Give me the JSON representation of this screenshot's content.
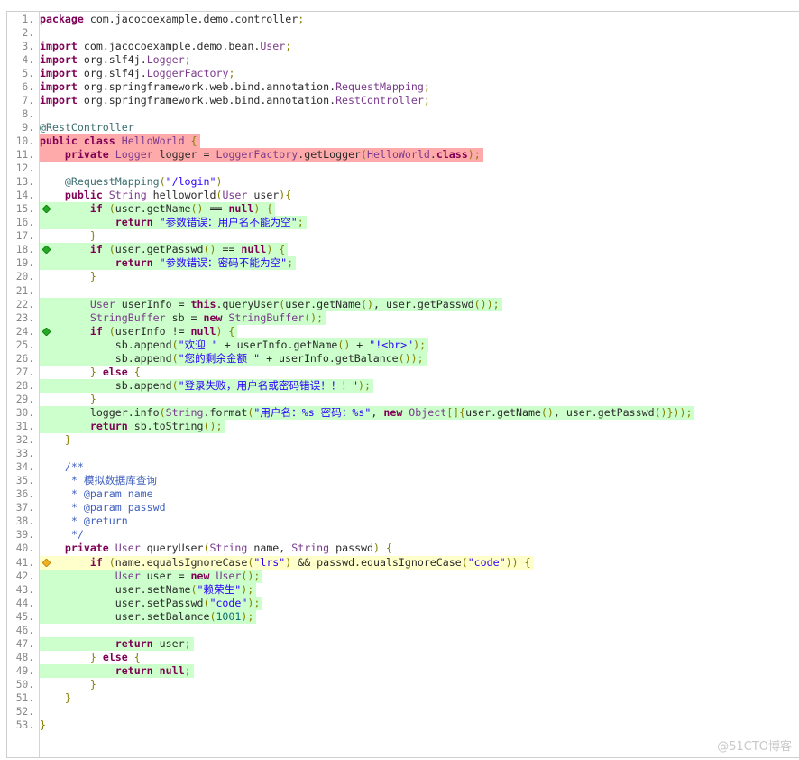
{
  "editor": {
    "language": "java",
    "coverage_colors": {
      "fully_covered": "#ccffcc",
      "not_covered": "#ffaaaa",
      "partially_covered": "#ffffcc",
      "branch_full_marker": "#22aa22",
      "branch_partial_marker": "#f0b020"
    },
    "lines": [
      {
        "n": "1.",
        "coverage": "none",
        "marker": "",
        "tokens": [
          [
            "kw",
            "package"
          ],
          [
            "",
            "com.jacocoexample.demo.controller"
          ],
          [
            "punc",
            ";"
          ]
        ]
      },
      {
        "n": "2.",
        "coverage": "none",
        "marker": "",
        "tokens": []
      },
      {
        "n": "3.",
        "coverage": "none",
        "marker": "",
        "tokens": [
          [
            "kw",
            "import"
          ],
          [
            "",
            "com.jacocoexample.demo.bean."
          ],
          [
            "ty",
            "User"
          ],
          [
            "punc",
            ";"
          ]
        ]
      },
      {
        "n": "4.",
        "coverage": "none",
        "marker": "",
        "tokens": [
          [
            "kw",
            "import"
          ],
          [
            "",
            "org.slf4j."
          ],
          [
            "ty",
            "Logger"
          ],
          [
            "punc",
            ";"
          ]
        ]
      },
      {
        "n": "5.",
        "coverage": "none",
        "marker": "",
        "tokens": [
          [
            "kw",
            "import"
          ],
          [
            "",
            "org.slf4j."
          ],
          [
            "ty",
            "LoggerFactory"
          ],
          [
            "punc",
            ";"
          ]
        ]
      },
      {
        "n": "6.",
        "coverage": "none",
        "marker": "",
        "tokens": [
          [
            "kw",
            "import"
          ],
          [
            "",
            "org.springframework.web.bind.annotation."
          ],
          [
            "ty",
            "RequestMapping"
          ],
          [
            "punc",
            ";"
          ]
        ]
      },
      {
        "n": "7.",
        "coverage": "none",
        "marker": "",
        "tokens": [
          [
            "kw",
            "import"
          ],
          [
            "",
            "org.springframework.web.bind.annotation."
          ],
          [
            "ty",
            "RestController"
          ],
          [
            "punc",
            ";"
          ]
        ]
      },
      {
        "n": "8.",
        "coverage": "none",
        "marker": "",
        "tokens": []
      },
      {
        "n": "9.",
        "coverage": "none",
        "marker": "",
        "tokens": [
          [
            "ann",
            "@RestController"
          ]
        ]
      },
      {
        "n": "10.",
        "coverage": "nc",
        "marker": "",
        "tokens": [
          [
            "kw",
            "public class"
          ],
          [
            "ty",
            " HelloWorld"
          ],
          [
            "punc",
            " {"
          ]
        ]
      },
      {
        "n": "11.",
        "coverage": "nc",
        "marker": "",
        "tokens": [
          [
            "",
            "    "
          ],
          [
            "kw",
            "private"
          ],
          [
            "ty",
            " Logger"
          ],
          [
            "",
            " logger = "
          ],
          [
            "ty",
            "LoggerFactory"
          ],
          [
            "",
            ".getLogger"
          ],
          [
            "punc",
            "("
          ],
          [
            "ty",
            "HelloWorld"
          ],
          [
            "",
            "."
          ],
          [
            "kw",
            "class"
          ],
          [
            "punc",
            ");"
          ]
        ]
      },
      {
        "n": "12.",
        "coverage": "none",
        "marker": "",
        "tokens": []
      },
      {
        "n": "13.",
        "coverage": "none",
        "marker": "",
        "tokens": [
          [
            "",
            "    "
          ],
          [
            "ann",
            "@RequestMapping"
          ],
          [
            "punc",
            "("
          ],
          [
            "str",
            "\"/login\""
          ],
          [
            "punc",
            ")"
          ]
        ]
      },
      {
        "n": "14.",
        "coverage": "none",
        "marker": "",
        "tokens": [
          [
            "",
            "    "
          ],
          [
            "kw",
            "public"
          ],
          [
            "ty",
            " String"
          ],
          [
            "",
            " helloworld"
          ],
          [
            "punc",
            "("
          ],
          [
            "ty",
            "User"
          ],
          [
            "",
            " user"
          ],
          [
            "punc",
            "){"
          ]
        ]
      },
      {
        "n": "15.",
        "coverage": "fc",
        "marker": "full",
        "tokens": [
          [
            "",
            "        "
          ],
          [
            "kw",
            "if"
          ],
          [
            "punc",
            " ("
          ],
          [
            "",
            "user.getName"
          ],
          [
            "punc",
            "()"
          ],
          [
            "",
            " == "
          ],
          [
            "kw",
            "null"
          ],
          [
            "punc",
            ") {"
          ]
        ]
      },
      {
        "n": "16.",
        "coverage": "fc",
        "marker": "",
        "tokens": [
          [
            "",
            "            "
          ],
          [
            "kw",
            "return"
          ],
          [
            "str",
            " \"参数错误：用户名不能为空\""
          ],
          [
            "punc",
            ";"
          ]
        ]
      },
      {
        "n": "17.",
        "coverage": "none",
        "marker": "",
        "tokens": [
          [
            "",
            "        "
          ],
          [
            "punc",
            "}"
          ]
        ]
      },
      {
        "n": "18.",
        "coverage": "fc",
        "marker": "full",
        "tokens": [
          [
            "",
            "        "
          ],
          [
            "kw",
            "if"
          ],
          [
            "punc",
            " ("
          ],
          [
            "",
            "user.getPasswd"
          ],
          [
            "punc",
            "()"
          ],
          [
            "",
            " == "
          ],
          [
            "kw",
            "null"
          ],
          [
            "punc",
            ") {"
          ]
        ]
      },
      {
        "n": "19.",
        "coverage": "fc",
        "marker": "",
        "tokens": [
          [
            "",
            "            "
          ],
          [
            "kw",
            "return"
          ],
          [
            "str",
            " \"参数错误：密码不能为空\""
          ],
          [
            "punc",
            ";"
          ]
        ]
      },
      {
        "n": "20.",
        "coverage": "none",
        "marker": "",
        "tokens": [
          [
            "",
            "        "
          ],
          [
            "punc",
            "}"
          ]
        ]
      },
      {
        "n": "21.",
        "coverage": "none",
        "marker": "",
        "tokens": []
      },
      {
        "n": "22.",
        "coverage": "fc",
        "marker": "",
        "tokens": [
          [
            "",
            "        "
          ],
          [
            "ty",
            "User"
          ],
          [
            "",
            " userInfo = "
          ],
          [
            "kw",
            "this"
          ],
          [
            "",
            ".queryUser"
          ],
          [
            "punc",
            "("
          ],
          [
            "",
            "user.getName"
          ],
          [
            "punc",
            "()"
          ],
          [
            "",
            ", user.getPasswd"
          ],
          [
            "punc",
            "());"
          ]
        ]
      },
      {
        "n": "23.",
        "coverage": "fc",
        "marker": "",
        "tokens": [
          [
            "",
            "        "
          ],
          [
            "ty",
            "StringBuffer"
          ],
          [
            "",
            " sb = "
          ],
          [
            "kw",
            "new"
          ],
          [
            "ty",
            " StringBuffer"
          ],
          [
            "punc",
            "();"
          ]
        ]
      },
      {
        "n": "24.",
        "coverage": "fc",
        "marker": "full",
        "tokens": [
          [
            "",
            "        "
          ],
          [
            "kw",
            "if"
          ],
          [
            "punc",
            " ("
          ],
          [
            "",
            "userInfo != "
          ],
          [
            "kw",
            "null"
          ],
          [
            "punc",
            ") {"
          ]
        ]
      },
      {
        "n": "25.",
        "coverage": "fc",
        "marker": "",
        "tokens": [
          [
            "",
            "            sb.append"
          ],
          [
            "punc",
            "("
          ],
          [
            "str",
            "\"欢迎 \""
          ],
          [
            "",
            " + userInfo.getName"
          ],
          [
            "punc",
            "()"
          ],
          [
            "",
            " + "
          ],
          [
            "str",
            "\"!<br>\""
          ],
          [
            "punc",
            ");"
          ]
        ]
      },
      {
        "n": "26.",
        "coverage": "fc",
        "marker": "",
        "tokens": [
          [
            "",
            "            sb.append"
          ],
          [
            "punc",
            "("
          ],
          [
            "str",
            "\"您的剩余金额 \""
          ],
          [
            "",
            " + userInfo.getBalance"
          ],
          [
            "punc",
            "());"
          ]
        ]
      },
      {
        "n": "27.",
        "coverage": "none",
        "marker": "",
        "tokens": [
          [
            "",
            "        "
          ],
          [
            "punc",
            "} "
          ],
          [
            "kw",
            "else"
          ],
          [
            "punc",
            " {"
          ]
        ]
      },
      {
        "n": "28.",
        "coverage": "fc",
        "marker": "",
        "tokens": [
          [
            "",
            "            sb.append"
          ],
          [
            "punc",
            "("
          ],
          [
            "str",
            "\"登录失败，用户名或密码错误！！！\""
          ],
          [
            "punc",
            ");"
          ]
        ]
      },
      {
        "n": "29.",
        "coverage": "none",
        "marker": "",
        "tokens": [
          [
            "",
            "        "
          ],
          [
            "punc",
            "}"
          ]
        ]
      },
      {
        "n": "30.",
        "coverage": "fc",
        "marker": "",
        "tokens": [
          [
            "",
            "        logger.info"
          ],
          [
            "punc",
            "("
          ],
          [
            "ty",
            "String"
          ],
          [
            "",
            ".format"
          ],
          [
            "punc",
            "("
          ],
          [
            "str",
            "\"用户名：%s 密码：%s\""
          ],
          [
            "",
            ", "
          ],
          [
            "kw",
            "new"
          ],
          [
            "ty",
            " Object"
          ],
          [
            "punc",
            "[]{"
          ],
          [
            "",
            "user.getName"
          ],
          [
            "punc",
            "()"
          ],
          [
            "",
            ", user.getPasswd"
          ],
          [
            "punc",
            "()}));"
          ]
        ]
      },
      {
        "n": "31.",
        "coverage": "fc",
        "marker": "",
        "tokens": [
          [
            "",
            "        "
          ],
          [
            "kw",
            "return"
          ],
          [
            "",
            " sb.toString"
          ],
          [
            "punc",
            "();"
          ]
        ]
      },
      {
        "n": "32.",
        "coverage": "none",
        "marker": "",
        "tokens": [
          [
            "",
            "    "
          ],
          [
            "punc",
            "}"
          ]
        ]
      },
      {
        "n": "33.",
        "coverage": "none",
        "marker": "",
        "tokens": []
      },
      {
        "n": "34.",
        "coverage": "none",
        "marker": "",
        "tokens": [
          [
            "cm",
            "    /**"
          ]
        ]
      },
      {
        "n": "35.",
        "coverage": "none",
        "marker": "",
        "tokens": [
          [
            "cm",
            "     * 模拟数据库查询"
          ]
        ]
      },
      {
        "n": "36.",
        "coverage": "none",
        "marker": "",
        "tokens": [
          [
            "cm",
            "     * @param name"
          ]
        ]
      },
      {
        "n": "37.",
        "coverage": "none",
        "marker": "",
        "tokens": [
          [
            "cm",
            "     * @param passwd"
          ]
        ]
      },
      {
        "n": "38.",
        "coverage": "none",
        "marker": "",
        "tokens": [
          [
            "cm",
            "     * @return"
          ]
        ]
      },
      {
        "n": "39.",
        "coverage": "none",
        "marker": "",
        "tokens": [
          [
            "cm",
            "     */"
          ]
        ]
      },
      {
        "n": "40.",
        "coverage": "none",
        "marker": "",
        "tokens": [
          [
            "",
            "    "
          ],
          [
            "kw",
            "private"
          ],
          [
            "ty",
            " User"
          ],
          [
            "",
            " queryUser"
          ],
          [
            "punc",
            "("
          ],
          [
            "ty",
            "String"
          ],
          [
            "",
            " name, "
          ],
          [
            "ty",
            "String"
          ],
          [
            "",
            " passwd"
          ],
          [
            "punc",
            ") {"
          ]
        ]
      },
      {
        "n": "41.",
        "coverage": "pc",
        "marker": "partial",
        "tokens": [
          [
            "",
            "        "
          ],
          [
            "kw",
            "if"
          ],
          [
            "punc",
            " ("
          ],
          [
            "",
            "name.equalsIgnoreCase"
          ],
          [
            "punc",
            "("
          ],
          [
            "str",
            "\"lrs\""
          ],
          [
            "punc",
            ")"
          ],
          [
            "",
            " && passwd.equalsIgnoreCase"
          ],
          [
            "punc",
            "("
          ],
          [
            "str",
            "\"code\""
          ],
          [
            "punc",
            ")) {"
          ]
        ]
      },
      {
        "n": "42.",
        "coverage": "fc",
        "marker": "",
        "tokens": [
          [
            "",
            "            "
          ],
          [
            "ty",
            "User"
          ],
          [
            "",
            " user = "
          ],
          [
            "kw",
            "new"
          ],
          [
            "ty",
            " User"
          ],
          [
            "punc",
            "();"
          ]
        ]
      },
      {
        "n": "43.",
        "coverage": "fc",
        "marker": "",
        "tokens": [
          [
            "",
            "            user.setName"
          ],
          [
            "punc",
            "("
          ],
          [
            "str",
            "\"赖荣生\""
          ],
          [
            "punc",
            ");"
          ]
        ]
      },
      {
        "n": "44.",
        "coverage": "fc",
        "marker": "",
        "tokens": [
          [
            "",
            "            user.setPasswd"
          ],
          [
            "punc",
            "("
          ],
          [
            "str",
            "\"code\""
          ],
          [
            "punc",
            ");"
          ]
        ]
      },
      {
        "n": "45.",
        "coverage": "fc",
        "marker": "",
        "tokens": [
          [
            "",
            "            user.setBalance"
          ],
          [
            "punc",
            "("
          ],
          [
            "num",
            "1001"
          ],
          [
            "punc",
            ");"
          ]
        ]
      },
      {
        "n": "46.",
        "coverage": "none",
        "marker": "",
        "tokens": []
      },
      {
        "n": "47.",
        "coverage": "fc",
        "marker": "",
        "tokens": [
          [
            "",
            "            "
          ],
          [
            "kw",
            "return"
          ],
          [
            "",
            " user"
          ],
          [
            "punc",
            ";"
          ]
        ]
      },
      {
        "n": "48.",
        "coverage": "none",
        "marker": "",
        "tokens": [
          [
            "",
            "        "
          ],
          [
            "punc",
            "} "
          ],
          [
            "kw",
            "else"
          ],
          [
            "punc",
            " {"
          ]
        ]
      },
      {
        "n": "49.",
        "coverage": "fc",
        "marker": "",
        "tokens": [
          [
            "",
            "            "
          ],
          [
            "kw",
            "return"
          ],
          [
            "kw",
            " null"
          ],
          [
            "punc",
            ";"
          ]
        ]
      },
      {
        "n": "50.",
        "coverage": "none",
        "marker": "",
        "tokens": [
          [
            "",
            "        "
          ],
          [
            "punc",
            "}"
          ]
        ]
      },
      {
        "n": "51.",
        "coverage": "none",
        "marker": "",
        "tokens": [
          [
            "",
            "    "
          ],
          [
            "punc",
            "}"
          ]
        ]
      },
      {
        "n": "52.",
        "coverage": "none",
        "marker": "",
        "tokens": []
      },
      {
        "n": "53.",
        "coverage": "none",
        "marker": "",
        "tokens": [
          [
            "punc",
            "}"
          ]
        ]
      }
    ]
  },
  "watermark": "@51CTO博客"
}
